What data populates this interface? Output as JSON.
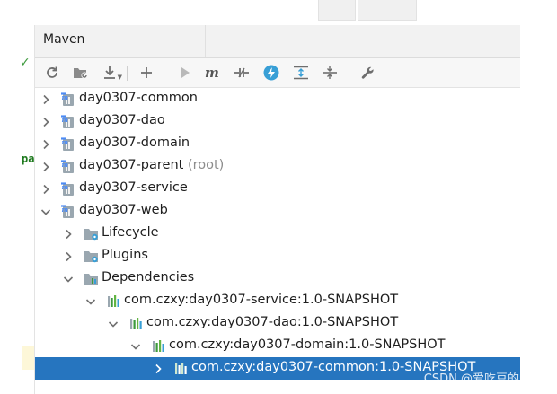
{
  "panel": {
    "title": "Maven"
  },
  "toolbar": {
    "buttons": [
      {
        "name": "reload-all-projects-button",
        "icon": "reload-icon"
      },
      {
        "name": "generate-sources-button",
        "icon": "folder-refresh-icon"
      },
      {
        "name": "download-sources-button",
        "icon": "download-icon"
      },
      {
        "name": "add-maven-project-button",
        "icon": "plus-icon"
      },
      {
        "name": "run-maven-build-button",
        "icon": "play-icon"
      },
      {
        "name": "execute-maven-goal-button",
        "icon": "maven-m-icon"
      },
      {
        "name": "toggle-offline-mode-button",
        "icon": "offline-icon"
      },
      {
        "name": "toggle-skip-tests-button",
        "icon": "lightning-icon"
      },
      {
        "name": "show-dependencies-button",
        "icon": "expand-icon"
      },
      {
        "name": "collapse-all-button",
        "icon": "collapse-icon"
      },
      {
        "name": "maven-settings-button",
        "icon": "wrench-icon"
      }
    ]
  },
  "tree": {
    "projects": [
      {
        "label": "day0307-common"
      },
      {
        "label": "day0307-dao"
      },
      {
        "label": "day0307-domain"
      },
      {
        "label": "day0307-parent",
        "suffix": "(root)"
      },
      {
        "label": "day0307-service"
      },
      {
        "label": "day0307-web"
      }
    ],
    "web_children": [
      {
        "label": "Lifecycle"
      },
      {
        "label": "Plugins"
      },
      {
        "label": "Dependencies"
      }
    ],
    "dependencies": [
      {
        "label": "com.czxy:day0307-service:1.0-SNAPSHOT"
      },
      {
        "label": "com.czxy:day0307-dao:1.0-SNAPSHOT"
      },
      {
        "label": "com.czxy:day0307-domain:1.0-SNAPSHOT"
      },
      {
        "label": "com.czxy:day0307-common:1.0-SNAPSHOT"
      }
    ]
  },
  "editor": {
    "gutter_text": "pa",
    "check": "✓"
  },
  "watermark": "CSDN @爱吃豆的土豆",
  "colors": {
    "selection": "#2675bf",
    "accent_blue": "#389fd6",
    "maven_blue": "#4c8bf5"
  }
}
